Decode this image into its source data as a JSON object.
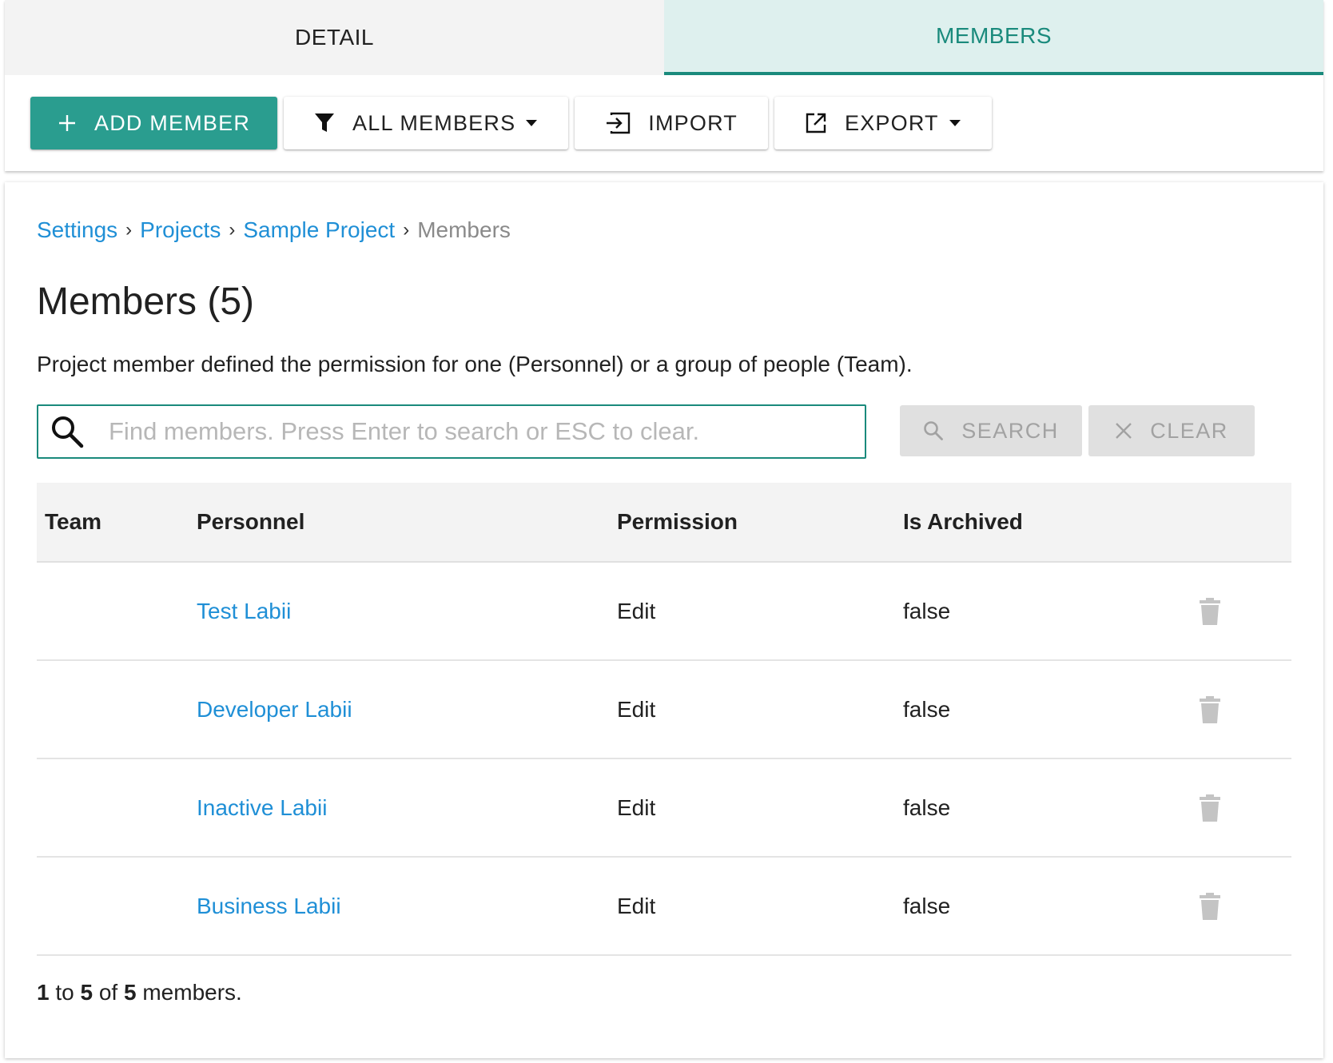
{
  "tabs": [
    {
      "label": "DETAIL",
      "active": false
    },
    {
      "label": "MEMBERS",
      "active": true
    }
  ],
  "toolbar": {
    "add_label": "ADD MEMBER",
    "filter_label": "ALL MEMBERS",
    "import_label": "IMPORT",
    "export_label": "EXPORT"
  },
  "breadcrumb": [
    {
      "label": "Settings"
    },
    {
      "label": "Projects"
    },
    {
      "label": "Sample Project"
    },
    {
      "label": "Members"
    }
  ],
  "page": {
    "title": "Members (5)",
    "description": "Project member defined the permission for one (Personnel) or a group of people (Team)."
  },
  "search": {
    "value": "",
    "placeholder": "Find members. Press Enter to search or ESC to clear.",
    "search_label": "SEARCH",
    "clear_label": "CLEAR"
  },
  "table": {
    "headers": {
      "team": "Team",
      "personnel": "Personnel",
      "permission": "Permission",
      "archived": "Is Archived"
    },
    "rows": [
      {
        "team": "",
        "personnel": "Test Labii",
        "permission": "Edit",
        "archived": "false"
      },
      {
        "team": "",
        "personnel": "Developer Labii",
        "permission": "Edit",
        "archived": "false"
      },
      {
        "team": "",
        "personnel": "Inactive Labii",
        "permission": "Edit",
        "archived": "false"
      },
      {
        "team": "",
        "personnel": "Business Labii",
        "permission": "Edit",
        "archived": "false"
      }
    ]
  },
  "footer": {
    "from": "1",
    "to_word": "to",
    "to": "5",
    "of_word": "of",
    "total": "5",
    "suffix": "members."
  },
  "colors": {
    "accent": "#2a9d8f",
    "tab_active_text": "#1a8a7c",
    "tab_active_bg": "#def0ee",
    "link": "#1f8fd6"
  },
  "icons": {
    "add": "plus-icon",
    "filter": "filter-icon",
    "import": "import-icon",
    "export": "export-icon",
    "search": "search-icon",
    "clear": "close-icon",
    "delete": "trash-icon"
  }
}
